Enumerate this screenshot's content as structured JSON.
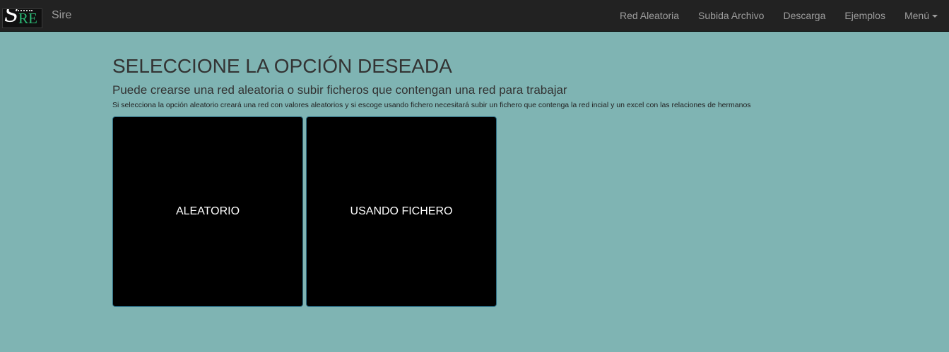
{
  "navbar": {
    "logo": {
      "letters_left": "S",
      "letters_right": "RE",
      "colors": {
        "s": "#ffffff",
        "re": "#2bb673",
        "background": "#101010"
      }
    },
    "brand": "Sire",
    "links": [
      {
        "label": "Red Aleatoria"
      },
      {
        "label": "Subida Archivo"
      },
      {
        "label": "Descarga"
      },
      {
        "label": "Ejemplos"
      },
      {
        "label": "Menú",
        "has_dropdown": true
      }
    ]
  },
  "main": {
    "title": "SELECCIONE LA OPCIÓN DESEADA",
    "subtitle": "Puede crearse una red aleatoria o subir ficheros que contengan una red para trabajar",
    "note": "Si selecciona la opción aleatorio creará una red con valores aleatorios y si escoge usando fichero necesitará subir un fichero que contenga la red incial y un excel con las relaciones de hermanos"
  },
  "options": [
    {
      "label": "ALEATORIO"
    },
    {
      "label": "USANDO FICHERO"
    }
  ],
  "colors": {
    "page_background": "#7fb4b3",
    "navbar_background": "#222222",
    "nav_text": "#9d9d9d",
    "card_background": "#000000",
    "card_text": "#ffffff"
  }
}
